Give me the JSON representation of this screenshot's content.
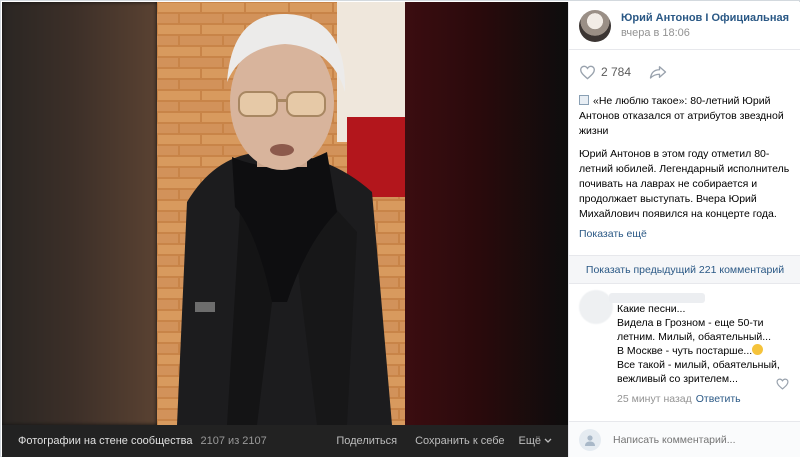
{
  "viewer": {
    "album_label": "Фотографии на стене сообщества",
    "photo_counter": "2107 из 2107",
    "share_label": "Поделиться",
    "save_label": "Сохранить к себе",
    "more_label": "Ещё"
  },
  "post": {
    "author": "Юрий Антонов I Официальная груп",
    "time": "вчера в 18:06",
    "likes": "2 784",
    "title": "«Не люблю такое»: 80-летний Юрий Антонов отказался от атрибутов звездной жизни",
    "body": "Юрий Антонов в этом году отметил 80-летний юбилей. Легендарный исполнитель почивать на лаврах не собирается и продолжает выступать. Вчера Юрий Михайлович появился на концерте года.",
    "show_more": "Показать ещё"
  },
  "comments": {
    "show_previous": "Показать предыдущий 221 комментарий",
    "items": [
      {
        "line1": "Какие песни...",
        "line2": "Видела в Грозном - еще 50-ти летним. Милый, обаятельный...",
        "line3a": "В Москве - чуть постарше...",
        "line3b": " Все такой - милый, обаятельный, вежливый со зрителем...",
        "time": "25 минут назад",
        "reply": "Ответить"
      }
    ],
    "input_placeholder": "Написать комментарий..."
  },
  "icons": {
    "like": "heart-icon",
    "share": "share-arrow-icon",
    "more": "chevron-down-icon",
    "post_type": "newspaper-icon",
    "emoji": "smiling-face-emoji"
  },
  "colors": {
    "link": "#2a5885",
    "viewer_bar": "#222222",
    "meta": "#939393"
  }
}
